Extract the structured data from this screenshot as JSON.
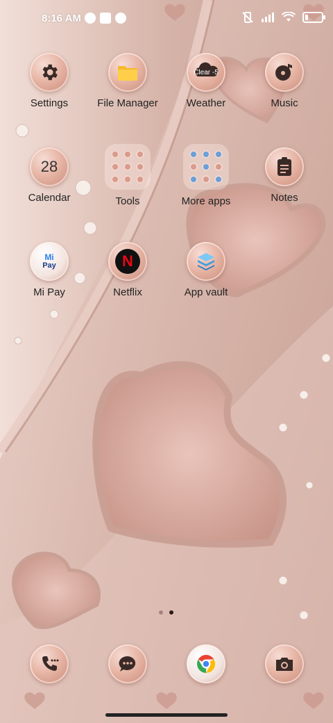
{
  "status": {
    "time": "8:16 AM",
    "battery_percent": 0.18
  },
  "apps": [
    {
      "label": "Settings",
      "icon": "gear-icon"
    },
    {
      "label": "File Manager",
      "icon": "folder-icon"
    },
    {
      "label": "Weather",
      "icon": "cloud-icon",
      "badge": "Clear -5"
    },
    {
      "label": "Music",
      "icon": "music-note-icon"
    },
    {
      "label": "Calendar",
      "icon": "calendar-icon",
      "date": "28"
    },
    {
      "label": "Tools",
      "icon": "folder-tools"
    },
    {
      "label": "More apps",
      "icon": "folder-more-apps"
    },
    {
      "label": "Notes",
      "icon": "notes-icon"
    },
    {
      "label": "Mi Pay",
      "icon": "mipay-icon",
      "brand_top": "Mi",
      "brand_bottom": "Pay"
    },
    {
      "label": "Netflix",
      "icon": "netflix-icon",
      "brand": "N"
    },
    {
      "label": "App vault",
      "icon": "app-vault-icon"
    }
  ],
  "dock": [
    {
      "name": "phone",
      "icon": "phone-icon"
    },
    {
      "name": "messages",
      "icon": "message-icon"
    },
    {
      "name": "chrome",
      "icon": "chrome-icon"
    },
    {
      "name": "camera",
      "icon": "camera-icon"
    }
  ],
  "colors": {
    "rose_gold": "#d8a697",
    "accent_red": "#e50914",
    "folder_yellow": "#f6b92b"
  }
}
